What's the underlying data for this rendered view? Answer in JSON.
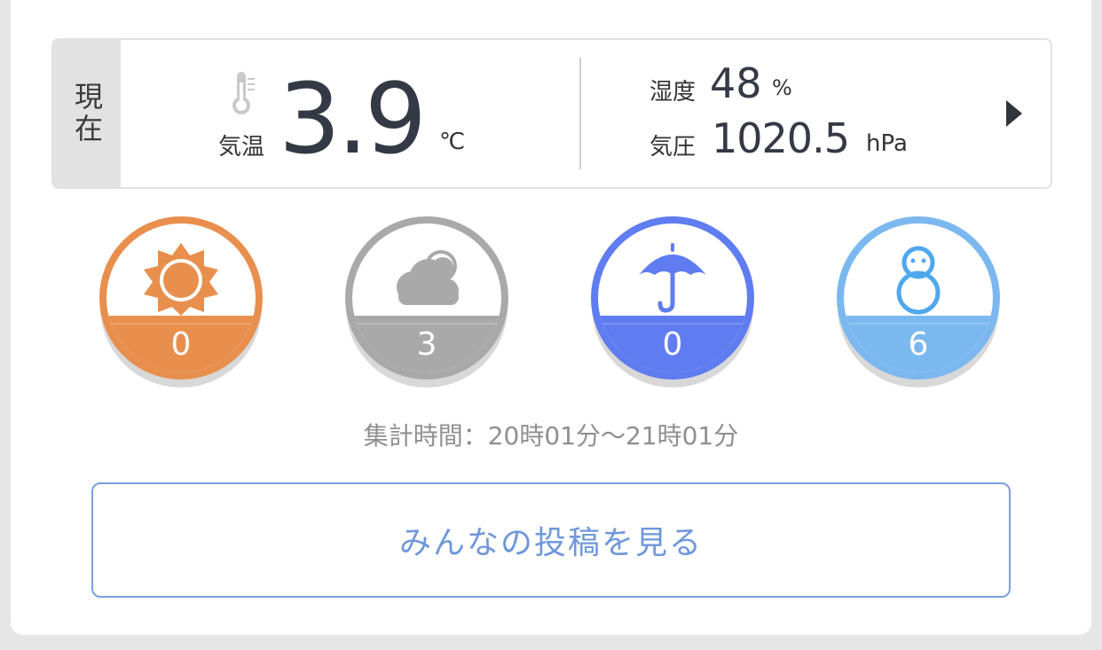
{
  "current": {
    "label": "現在",
    "temperature": {
      "label": "気温",
      "value": "3.9",
      "unit": "℃"
    },
    "humidity": {
      "label": "湿度",
      "value": "48",
      "unit": "%"
    },
    "pressure": {
      "label": "気圧",
      "value": "1020.5",
      "unit": "hPa"
    },
    "detail_arrow": "play-right-icon"
  },
  "votes": [
    {
      "icon": "sun-icon",
      "count": "0",
      "color": "#e88f4e"
    },
    {
      "icon": "cloud-icon",
      "count": "3",
      "color": "#a9a9a9"
    },
    {
      "icon": "umbrella-icon",
      "count": "0",
      "color": "#5f7cf0"
    },
    {
      "icon": "snowman-icon",
      "count": "6",
      "color": "#7cb8f0"
    }
  ],
  "period": "集計時間：20時01分〜21時01分",
  "posts_button": "みんなの投稿を見る"
}
